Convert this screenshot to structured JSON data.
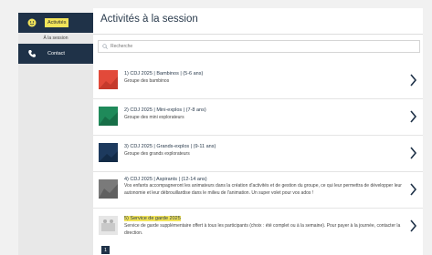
{
  "sidebar": {
    "items": [
      {
        "label": "Activités",
        "icon": "smiley-icon",
        "active": true
      },
      {
        "label": "À la session"
      },
      {
        "label": "Contact",
        "icon": "phone-icon"
      }
    ]
  },
  "main": {
    "title": "Activités à la session",
    "search": {
      "placeholder": "Recherche"
    },
    "activities": [
      {
        "name": "1) CDJ 2025 | Bambinos | (5-6 ans)",
        "desc": "Groupe des bambinos",
        "color": "#e24a3a"
      },
      {
        "name": "2) CDJ 2025 | Mini-explos | (7-8 ans)",
        "desc": "Groupe des mini explorateurs",
        "color": "#1f8a5a"
      },
      {
        "name": "3) CDJ 2025 | Grands-explos | (9-11 ans)",
        "desc": "Groupe des grands explorateurs",
        "color": "#1d3a5e"
      },
      {
        "name": "4) CDJ 2025 | Aspirants | (12-14 ans)",
        "desc": "Vos enfants accompagneront les animateurs dans la création d'activités et de gestion du groupe, ce qui leur permettra de développer leur autonomie et leur débrouillardise dans le milieu de l'animation. Un super volet pour vos ados !",
        "color": "#7a7a7a"
      },
      {
        "name": "5) Service de garde 2025",
        "desc": "Service de garde supplémentaire offert à tous les participants (choix : été complet ou à la semaine). Pour payer à la journée, contacter la direction.",
        "color": "#c9c9c9"
      }
    ]
  },
  "pagination": {
    "current": "1"
  },
  "colors": {
    "navy": "#1f3248",
    "highlight": "#f2e45a",
    "accent": "#1f3248"
  }
}
